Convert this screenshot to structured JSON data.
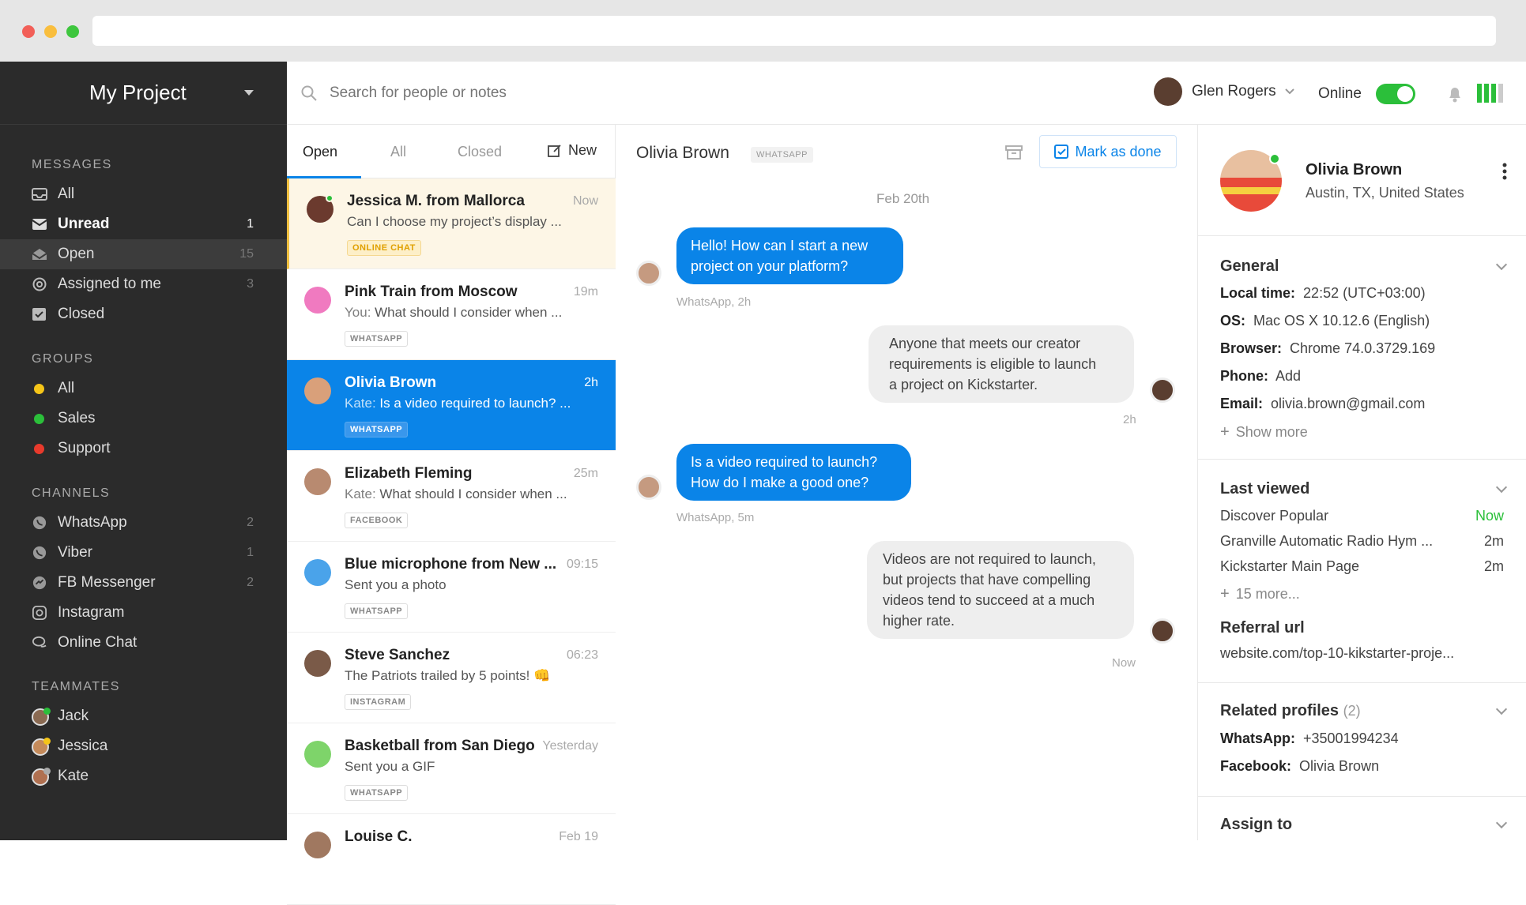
{
  "sidebar": {
    "project": "My Project",
    "messages_header": "MESSAGES",
    "messages": [
      {
        "label": "All",
        "count": ""
      },
      {
        "label": "Unread",
        "count": "1"
      },
      {
        "label": "Open",
        "count": "15"
      },
      {
        "label": "Assigned to me",
        "count": "3"
      },
      {
        "label": "Closed",
        "count": ""
      }
    ],
    "groups_header": "GROUPS",
    "groups": [
      {
        "label": "All",
        "color": "#f5c518"
      },
      {
        "label": "Sales",
        "color": "#2bbf3a"
      },
      {
        "label": "Support",
        "color": "#e83a2c"
      }
    ],
    "channels_header": "CHANNELS",
    "channels": [
      {
        "label": "WhatsApp",
        "count": "2"
      },
      {
        "label": "Viber",
        "count": "1"
      },
      {
        "label": "FB Messenger",
        "count": "2"
      },
      {
        "label": "Instagram",
        "count": ""
      },
      {
        "label": "Online Chat",
        "count": ""
      }
    ],
    "teammates_header": "TEAMMATES",
    "teammates": [
      {
        "label": "Jack",
        "status": "#2bbf3a"
      },
      {
        "label": "Jessica",
        "status": "#f5c518"
      },
      {
        "label": "Kate",
        "status": "#aaaaaa"
      }
    ]
  },
  "topbar": {
    "search_placeholder": "Search for people or notes",
    "user_name": "Glen Rogers",
    "status": "Online"
  },
  "list": {
    "tabs": [
      "Open",
      "All",
      "Closed"
    ],
    "new_label": "New",
    "conversations": [
      {
        "name": "Jessica M. from Mallorca",
        "time": "Now",
        "preview": "Can I choose my project’s display ...",
        "prefix": "",
        "tag": "ONLINE CHAT",
        "avatar": "#6b3a2e"
      },
      {
        "name": "Pink Train from Moscow",
        "time": "19m",
        "preview": "What should I consider when ...",
        "prefix": "You: ",
        "tag": "WHATSAPP",
        "avatar": "#f07ac0"
      },
      {
        "name": "Olivia Brown",
        "time": "2h",
        "preview": "Is a video required to launch? ...",
        "prefix": "Kate: ",
        "tag": "WHATSAPP",
        "avatar": "#d9a07a"
      },
      {
        "name": "Elizabeth Fleming",
        "time": "25m",
        "preview": "What should I consider when ...",
        "prefix": "Kate: ",
        "tag": "FACEBOOK",
        "avatar": "#b88a70"
      },
      {
        "name": "Blue microphone from New ...",
        "time": "09:15",
        "preview": "Sent you a photo",
        "prefix": "",
        "tag": "WHATSAPP",
        "avatar": "#4aa3ea"
      },
      {
        "name": "Steve Sanchez",
        "time": "06:23",
        "preview": "The Patriots trailed by 5 points! 👊",
        "prefix": "",
        "tag": "INSTAGRAM",
        "avatar": "#7a5a48"
      },
      {
        "name": "Basketball from San Diego",
        "time": "Yesterday",
        "preview": "Sent you a GIF",
        "prefix": "",
        "tag": "WHATSAPP",
        "avatar": "#7ed46a"
      },
      {
        "name": "Louise C.",
        "time": "Feb 19",
        "preview": "",
        "prefix": "",
        "tag": "",
        "avatar": "#a07860"
      }
    ]
  },
  "chat": {
    "name": "Olivia Brown",
    "channel": "WHATSAPP",
    "mark_done": "Mark as done",
    "date": "Feb 20th",
    "messages": [
      {
        "text1": "Hello! How can I start a new",
        "text2": "project on your platform?",
        "meta": "WhatsApp, 2h"
      },
      {
        "text1": "Anyone that meets our creator",
        "text2": "requirements is eligible to launch",
        "text3": "a project on Kickstarter.",
        "meta": "2h"
      },
      {
        "text1": "Is a video required to launch?",
        "text2": "How do I make a good one?",
        "meta": "WhatsApp, 5m"
      },
      {
        "text1": "Videos are not required to launch,",
        "text2": "but projects that have compelling",
        "text3": "videos tend to succeed at a much",
        "text4": "higher rate.",
        "meta": "Now"
      }
    ]
  },
  "profile": {
    "name": "Olivia Brown",
    "location": "Austin, TX, United States",
    "general_title": "General",
    "local_time_k": "Local time:",
    "local_time_v": "22:52 (UTC+03:00)",
    "os_k": "OS:",
    "os_v": "Mac OS X 10.12.6 (English)",
    "browser_k": "Browser:",
    "browser_v": "Chrome 74.0.3729.169",
    "phone_k": "Phone:",
    "phone_v": "Add",
    "email_k": "Email:",
    "email_v": "olivia.brown@gmail.com",
    "show_more": "Show more",
    "last_viewed_title": "Last viewed",
    "viewed": [
      {
        "page": "Discover Popular",
        "time": "Now"
      },
      {
        "page": "Granville Automatic Radio Hym ...",
        "time": "2m"
      },
      {
        "page": "Kickstarter Main Page",
        "time": "2m"
      }
    ],
    "more_pages": "15 more...",
    "referral_title": "Referral url",
    "referral_v": "website.com/top-10-kikstarter-proje...",
    "related_title": "Related profiles",
    "related_count": "(2)",
    "wa_k": "WhatsApp:",
    "wa_v": "+35001994234",
    "fb_k": "Facebook:",
    "fb_v": "Olivia Brown",
    "assign_title": "Assign to"
  }
}
